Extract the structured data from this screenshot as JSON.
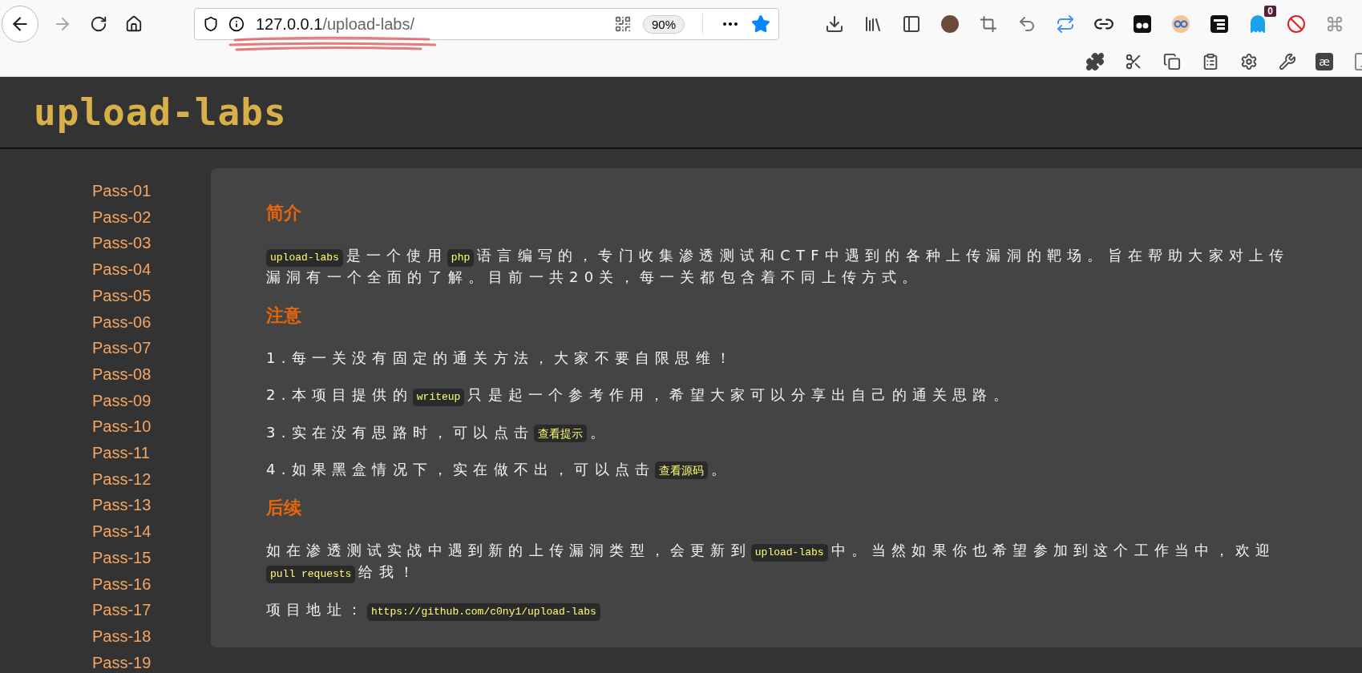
{
  "browser": {
    "url_host": "127.0.0.1",
    "url_path": "/upload-labs/",
    "zoom": "90%",
    "forward_disabled": true,
    "extension_badge": "0",
    "ae_label": "æ"
  },
  "logo": "upload-labs",
  "sidebar": {
    "items": [
      "Pass-01",
      "Pass-02",
      "Pass-03",
      "Pass-04",
      "Pass-05",
      "Pass-06",
      "Pass-07",
      "Pass-08",
      "Pass-09",
      "Pass-10",
      "Pass-11",
      "Pass-12",
      "Pass-13",
      "Pass-14",
      "Pass-15",
      "Pass-16",
      "Pass-17",
      "Pass-18",
      "Pass-19"
    ]
  },
  "sections": [
    {
      "heading": "简介",
      "paragraphs": [
        {
          "lines": [
            [
              {
                "kind": "code",
                "text": "upload-labs"
              },
              {
                "kind": "text",
                "text": "是一个使用"
              },
              {
                "kind": "code",
                "text": "php"
              },
              {
                "kind": "text",
                "text": "语言编写的，专门收集渗透测试和CTF中遇到的各种上传漏洞的靶场。旨在帮助大家对上传"
              }
            ],
            [
              {
                "kind": "text",
                "text": "漏洞有一个全面的了解。目前一共20关，每一关都包含着不同上传方式。"
              }
            ]
          ]
        }
      ]
    },
    {
      "heading": "注意",
      "paragraphs": [
        {
          "lines": [
            [
              {
                "kind": "text",
                "text": "1.每一关没有固定的通关方法，大家不要自限思维！"
              }
            ]
          ]
        },
        {
          "lines": [
            [
              {
                "kind": "text",
                "text": "2.本项目提供的"
              },
              {
                "kind": "code",
                "text": "writeup"
              },
              {
                "kind": "text",
                "text": "只是起一个参考作用，希望大家可以分享出自己的通关思路。"
              }
            ]
          ]
        },
        {
          "lines": [
            [
              {
                "kind": "text",
                "text": "3.实在没有思路时，可以点击"
              },
              {
                "kind": "button",
                "text": "查看提示"
              },
              {
                "kind": "text",
                "text": "。"
              }
            ]
          ]
        },
        {
          "lines": [
            [
              {
                "kind": "text",
                "text": "4.如果黑盒情况下，实在做不出，可以点击"
              },
              {
                "kind": "button",
                "text": "查看源码"
              },
              {
                "kind": "text",
                "text": "。"
              }
            ]
          ]
        }
      ]
    },
    {
      "heading": "后续",
      "paragraphs": [
        {
          "lines": [
            [
              {
                "kind": "text",
                "text": "如在渗透测试实战中遇到新的上传漏洞类型，会更新到"
              },
              {
                "kind": "code",
                "text": "upload-labs"
              },
              {
                "kind": "text",
                "text": "中。当然如果你也希望参加到这个工作当中，欢迎"
              }
            ],
            [
              {
                "kind": "code",
                "text": "pull requests"
              },
              {
                "kind": "text",
                "text": "给我！"
              }
            ]
          ]
        },
        {
          "lines": [
            [
              {
                "kind": "text",
                "text": "项目地址："
              },
              {
                "kind": "code",
                "text": "https://github.com/c0ny1/upload-labs"
              }
            ]
          ]
        }
      ]
    }
  ]
}
